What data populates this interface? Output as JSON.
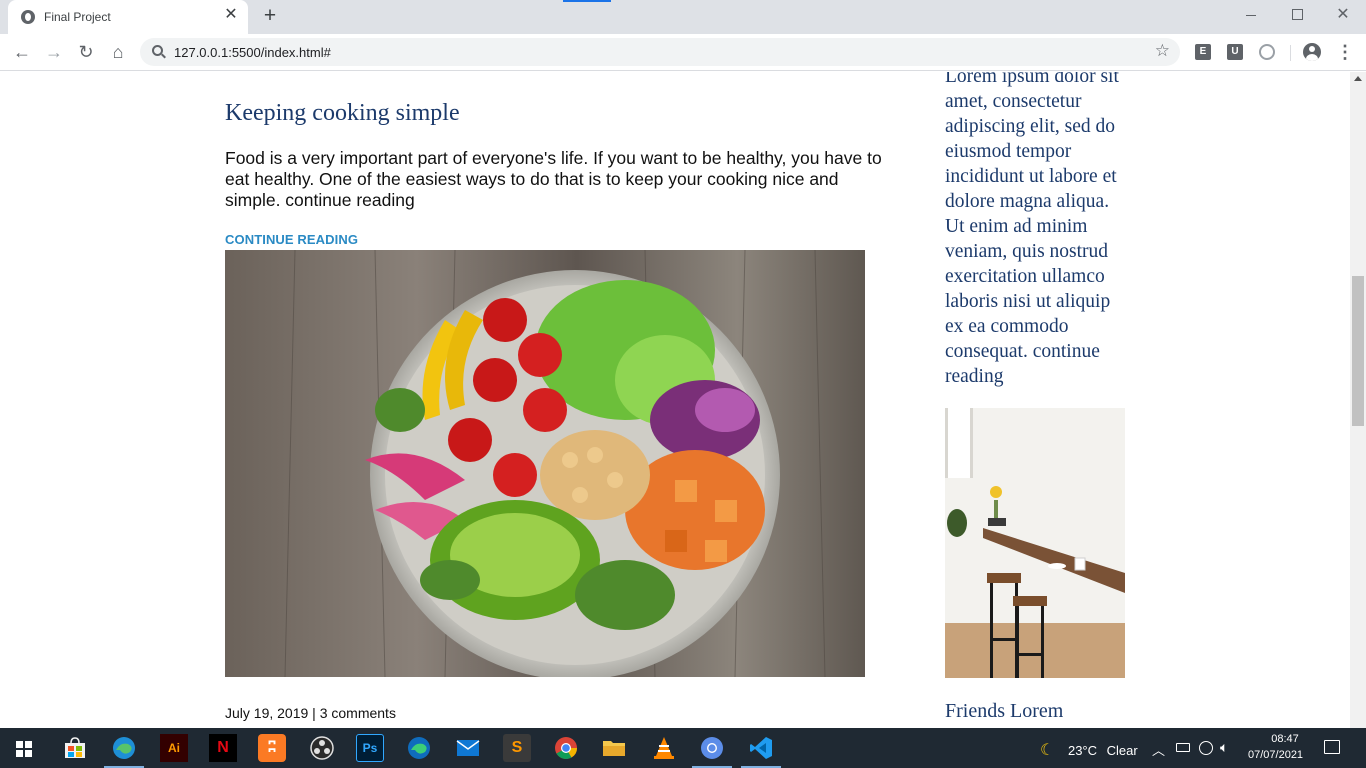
{
  "browser": {
    "tab_title": "Final Project",
    "url": "127.0.0.1:5500/index.html#",
    "extensions": [
      "E",
      "U"
    ]
  },
  "post": {
    "title": "Keeping cooking simple",
    "excerpt": "Food is a very important part of everyone's life. If you want to be healthy, you have to eat healthy. One of the easiest ways to do that is to keep your cooking nice and simple. continue reading",
    "link_label": "CONTINUE READING",
    "meta": "July 19, 2019 | 3 comments"
  },
  "sidebar": {
    "text": "Lorem ipsum dolor sit amet, consectetur adipiscing elit, sed do eiusmod tempor incididunt ut labore et dolore magna aliqua. Ut enim ad minim veniam, quis nostrud exercitation ullamco laboris nisi ut aliquip ex ea commodo consequat. continue reading",
    "heading": "Friends Lorem"
  },
  "taskbar": {
    "apps": [
      "edge-beta",
      "microsoft-store",
      "edge",
      "illustrator",
      "netflix",
      "xampp",
      "obs",
      "photoshop",
      "edge-dev",
      "mail",
      "sublime-text",
      "chrome",
      "file-explorer",
      "vlc",
      "chromium",
      "vscode"
    ],
    "weather_temp": "23°C",
    "weather_desc": "Clear",
    "time": "08:47",
    "date": "07/07/2021"
  },
  "colors": {
    "heading": "#1c3a6b",
    "link": "#2a8ac4",
    "taskbar": "#1f2933"
  }
}
